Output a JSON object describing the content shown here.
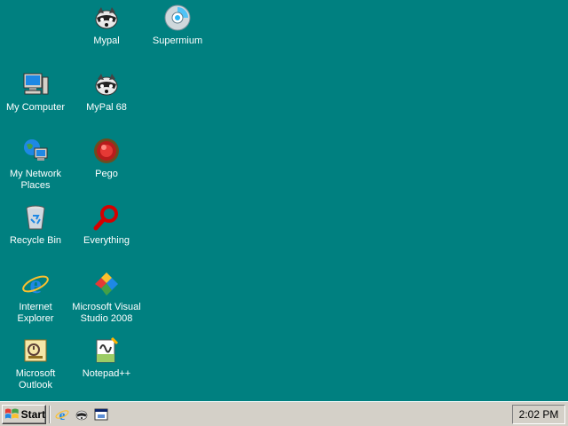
{
  "desktop": {
    "background_color": "#008080",
    "icons": [
      {
        "label": "Mypal",
        "icon": "raccoon-icon"
      },
      {
        "label": "Supermium",
        "icon": "supermium-icon"
      },
      {
        "label": "My Computer",
        "icon": "computer-icon"
      },
      {
        "label": "MyPal 68",
        "icon": "raccoon-icon"
      },
      {
        "label": "My Network\nPlaces",
        "icon": "network-places-icon"
      },
      {
        "label": "Pego",
        "icon": "red-button-icon"
      },
      {
        "label": "Recycle Bin",
        "icon": "recycle-bin-icon"
      },
      {
        "label": "Everything",
        "icon": "magnifier-icon"
      },
      {
        "label": "Internet\nExplorer",
        "icon": "internet-explorer-icon"
      },
      {
        "label": "Microsoft Visual\nStudio 2008",
        "icon": "visual-studio-icon"
      },
      {
        "label": "Microsoft\nOutlook",
        "icon": "outlook-icon"
      },
      {
        "label": "Notepad++",
        "icon": "notepad-plus-plus-icon"
      }
    ]
  },
  "taskbar": {
    "start_label": "Start",
    "quick_launch": [
      {
        "name": "internet-explorer-icon"
      },
      {
        "name": "raccoon-icon"
      },
      {
        "name": "show-desktop-icon"
      }
    ],
    "clock": "2:02 PM",
    "background_color": "#d4d0c8"
  }
}
